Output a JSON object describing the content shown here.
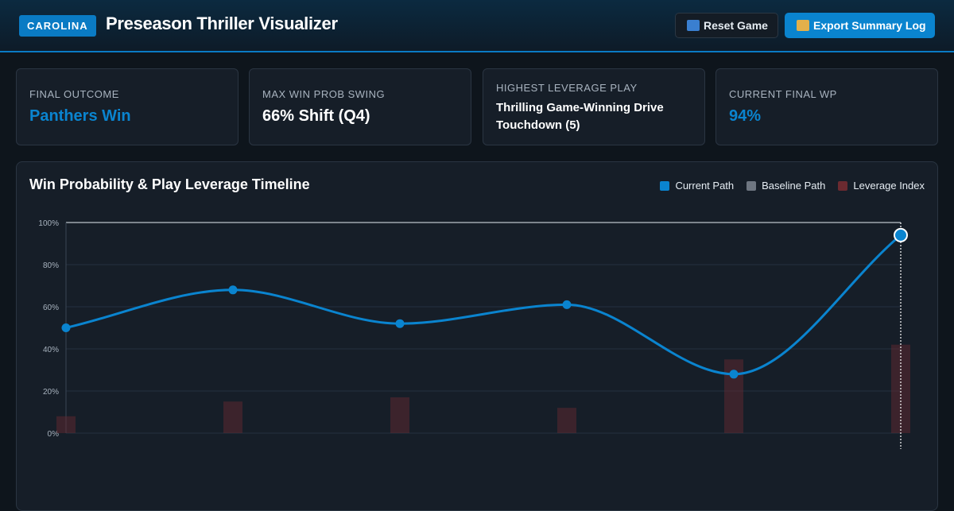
{
  "header": {
    "brand": "CAROLINA",
    "title": "Preseason Thriller Visualizer",
    "reset_label": "Reset Game",
    "export_label": "Export Summary Log",
    "reset_icon": "refresh-icon",
    "export_icon": "inbox-tray-icon"
  },
  "cards": [
    {
      "label": "Final Outcome",
      "value": "Panthers Win"
    },
    {
      "label": "Max Win Prob Swing",
      "value": "66% Shift (Q4)"
    },
    {
      "label": "Highest Leverage Play",
      "value": "Thrilling Game-Winning Drive Touchdown (5)"
    },
    {
      "label": "Current Final WP",
      "value": "94%"
    }
  ],
  "colors": {
    "accent": "#0a84cf",
    "background": "#0e151c",
    "panel": "#161e28",
    "leverage": "#6b2a30",
    "baseline": "#6e7681"
  },
  "chart": {
    "title": "Win Probability & Play Leverage Timeline",
    "legend": [
      {
        "name": "Current Path",
        "color": "#0a84cf"
      },
      {
        "name": "Baseline Path",
        "color": "#6e7681"
      },
      {
        "name": "Leverage Index",
        "color": "#6b2a30"
      }
    ]
  },
  "chart_data": {
    "type": "line",
    "title": "Win Probability & Play Leverage Timeline",
    "y_ticks": [
      "0%",
      "20%",
      "40%",
      "60%",
      "80%",
      "100%"
    ],
    "ylim": [
      0,
      100
    ],
    "x": [
      0,
      1,
      2,
      3,
      4,
      5
    ],
    "series": [
      {
        "name": "Current Path",
        "type": "line",
        "values": [
          50,
          68,
          52,
          61,
          28,
          94
        ]
      },
      {
        "name": "Leverage Index",
        "type": "bar",
        "values": [
          8,
          15,
          17,
          12,
          35,
          42
        ]
      }
    ],
    "grid": true,
    "legend_position": "top-right"
  }
}
